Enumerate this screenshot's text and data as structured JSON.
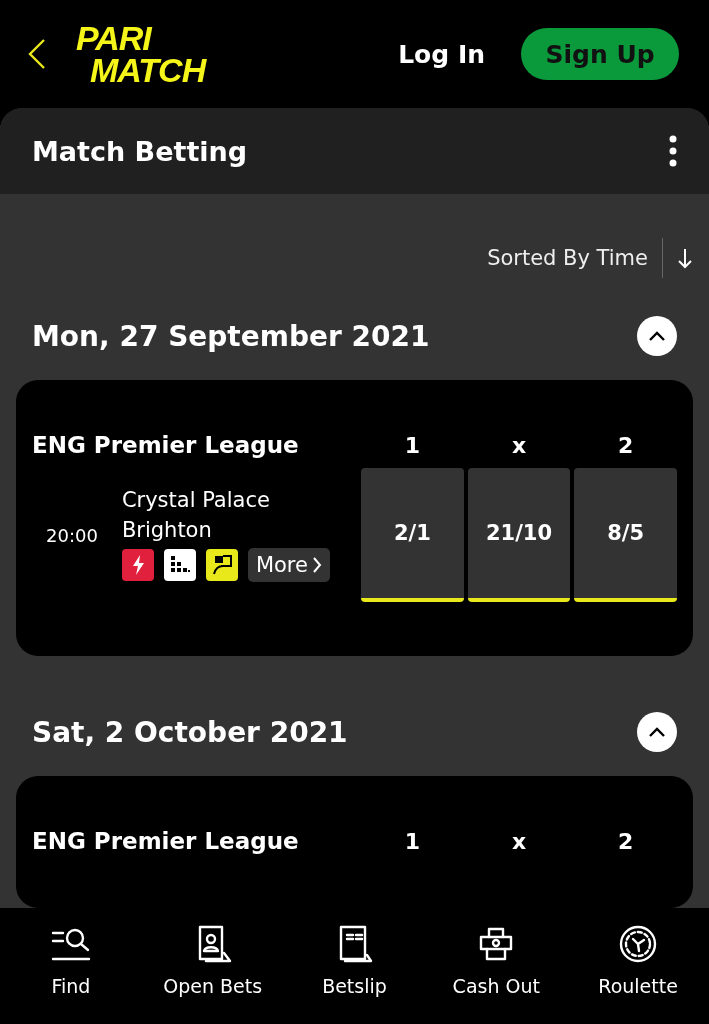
{
  "header": {
    "logo": [
      "PARI",
      "MATCH"
    ],
    "login": "Log In",
    "signup": "Sign Up"
  },
  "panel": {
    "title": "Match Betting"
  },
  "sort": {
    "label": "Sorted By Time"
  },
  "days": [
    {
      "date": "Mon, 27 September 2021",
      "expanded": true,
      "matches": [
        {
          "league": "ENG Premier League",
          "columns": [
            "1",
            "x",
            "2"
          ],
          "time": "20:00",
          "home": "Crystal Palace",
          "away": "Brighton",
          "more": "More",
          "odds": [
            "2/1",
            "21/10",
            "8/5"
          ]
        }
      ]
    },
    {
      "date": "Sat, 2 October 2021",
      "expanded": true,
      "matches": [
        {
          "league": "ENG Premier League",
          "columns": [
            "1",
            "x",
            "2"
          ]
        }
      ]
    }
  ],
  "nav": [
    {
      "label": "Find",
      "kind": "find"
    },
    {
      "label": "Open Bets",
      "kind": "openbets"
    },
    {
      "label": "Betslip",
      "kind": "betslip"
    },
    {
      "label": "Cash Out",
      "kind": "cashout"
    },
    {
      "label": "Roulette",
      "kind": "roulette"
    }
  ]
}
